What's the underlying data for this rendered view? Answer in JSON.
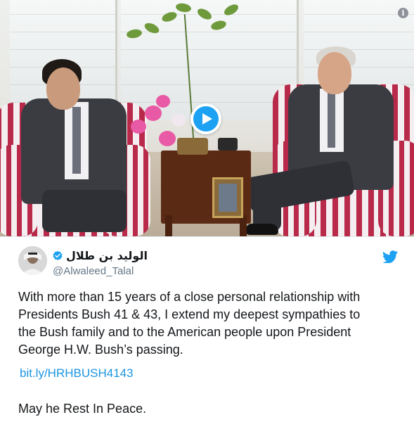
{
  "media": {
    "play_label": "Play video",
    "info_label": "i"
  },
  "tweet": {
    "display_name": "الوليد بن طلال",
    "handle": "@Alwaleed_Talal",
    "body_lines": [
      "With more than 15 years of a close personal relationship with",
      "Presidents Bush 41 & 43, I extend my deepest sympathies to",
      "the Bush family and to the American people upon President",
      "George H.W. Bush’s passing."
    ],
    "link": "bit.ly/HRHBUSH4143",
    "closing": "May he Rest In Peace."
  },
  "colors": {
    "accent": "#1da1f2",
    "link": "#1b95e0",
    "handle": "#657786",
    "text": "#14171a"
  },
  "icons": [
    "play-icon",
    "info-icon",
    "verified-badge-icon",
    "twitter-bird-icon"
  ]
}
